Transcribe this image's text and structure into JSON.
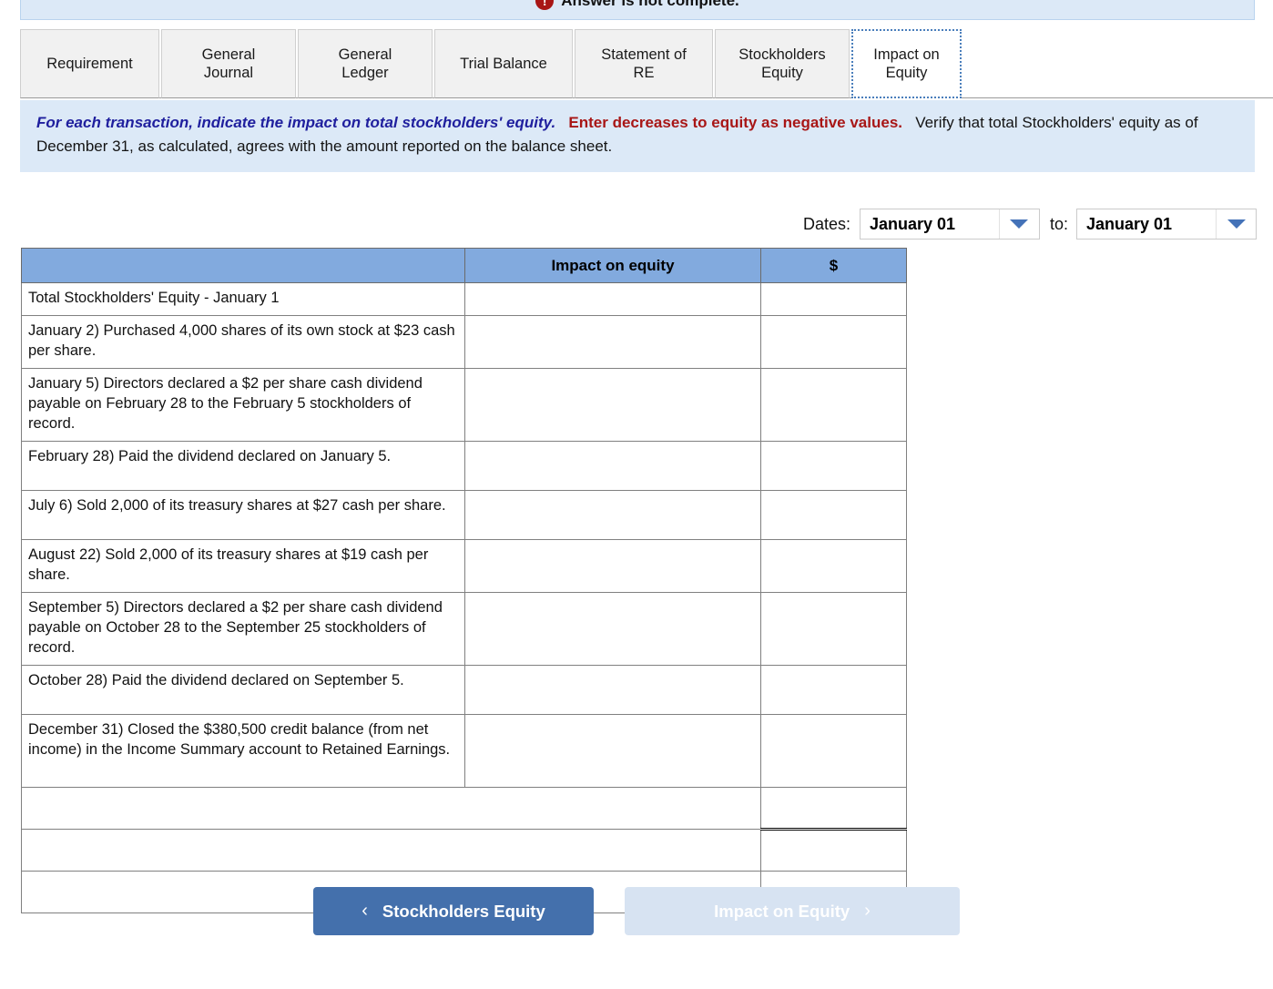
{
  "alert": {
    "badge": "!",
    "text": "Answer is not complete."
  },
  "tabs": [
    {
      "label": "Requirement",
      "active": false
    },
    {
      "label": "General\nJournal",
      "active": false
    },
    {
      "label": "General\nLedger",
      "active": false
    },
    {
      "label": "Trial Balance",
      "active": false
    },
    {
      "label": "Statement of\nRE",
      "active": false
    },
    {
      "label": "Stockholders\nEquity",
      "active": false
    },
    {
      "label": "Impact on\nEquity",
      "active": true
    }
  ],
  "instructions": {
    "part1": "For each transaction, indicate the impact on total stockholders' equity.",
    "part2": "Enter decreases to equity as negative values.",
    "part3": "Verify that total Stockholders' equity as of December 31, as calculated, agrees with the amount reported on the balance sheet."
  },
  "dates": {
    "label": "Dates:",
    "from_value": "January 01",
    "to_label": "to:",
    "to_value": "January 01"
  },
  "table": {
    "headers": [
      "",
      "Impact on equity",
      "$"
    ],
    "rows": [
      {
        "desc": "Total Stockholders' Equity - January 1",
        "impact": "",
        "amount": "",
        "height": "row-h1"
      },
      {
        "desc": "January 2)  Purchased 4,000 shares of its own stock at $23 cash per share.",
        "impact": "",
        "amount": "",
        "height": "row-h2"
      },
      {
        "desc": "January 5)  Directors declared a $2 per share cash dividend payable on February 28 to the February 5 stockholders of record.",
        "impact": "",
        "amount": "",
        "height": "row-h3"
      },
      {
        "desc": "February 28)  Paid the dividend declared on January 5.",
        "impact": "",
        "amount": "",
        "height": "row-h2"
      },
      {
        "desc": "July 6)  Sold 2,000 of its treasury shares at $27 cash per share.",
        "impact": "",
        "amount": "",
        "height": "row-h2"
      },
      {
        "desc": "August 22)  Sold 2,000 of its treasury shares at $19 cash per share.",
        "impact": "",
        "amount": "",
        "height": "row-h2"
      },
      {
        "desc": "September 5)  Directors declared a $2 per share cash dividend payable on October 28 to the September 25 stockholders of record.",
        "impact": "",
        "amount": "",
        "height": "row-h3"
      },
      {
        "desc": "October 28)  Paid the dividend declared on September 5.",
        "impact": "",
        "amount": "",
        "height": "row-h2"
      },
      {
        "desc": "December 31)  Closed the $380,500 credit balance (from net income) in the Income Summary account to Retained Earnings.",
        "impact": "",
        "amount": "",
        "height": "row-h3"
      }
    ],
    "total_rows": [
      {
        "desc": "",
        "amount": "",
        "amount_style": "amt-dbl-bottom"
      },
      {
        "desc": "",
        "amount": "",
        "amount_style": "amt-plain"
      },
      {
        "desc": "",
        "amount": "",
        "amount_style": "amt-plain"
      }
    ]
  },
  "nav": {
    "prev_chevron": "‹",
    "prev_label": "Stockholders Equity",
    "next_label": "Impact on Equity",
    "next_chevron": "›"
  },
  "colors": {
    "header_blue": "#82AADE",
    "banner_blue": "#DCE9F7",
    "accent_blue": "#4472B8",
    "prev_button": "#4470AC",
    "next_button": "#D7E3F2",
    "instruction_blue": "#1F1F9E",
    "instruction_red": "#A81616"
  }
}
